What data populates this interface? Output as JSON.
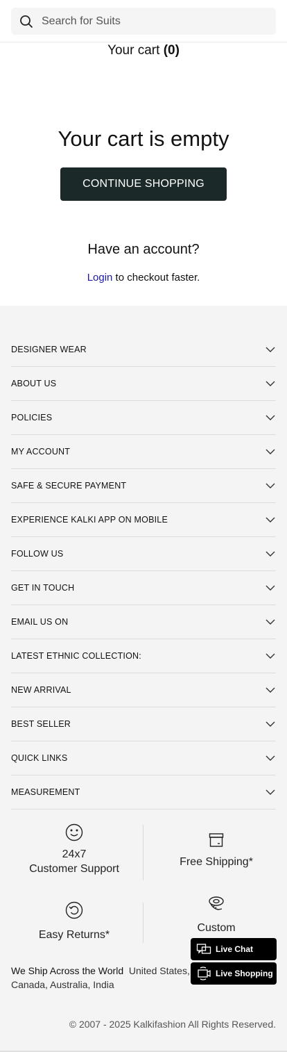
{
  "search": {
    "placeholder": "Search for Suits"
  },
  "cart": {
    "label": "Your cart",
    "count": "(0)"
  },
  "empty": {
    "title": "Your cart is empty",
    "button": "CONTINUE SHOPPING"
  },
  "account": {
    "title": "Have an account?",
    "login": "Login",
    "suffix": " to checkout faster."
  },
  "footer": {
    "sections": [
      "DESIGNER WEAR",
      "ABOUT US",
      "POLICIES",
      "MY ACCOUNT",
      "SAFE & SECURE PAYMENT",
      "EXPERIENCE KALKI APP ON MOBILE",
      "FOLLOW US",
      "GET IN TOUCH",
      "EMAIL US ON",
      "LATEST ETHNIC COLLECTION:",
      "NEW ARRIVAL",
      "BEST SELLER",
      "QUICK LINKS",
      "MEASUREMENT"
    ],
    "features": {
      "support_line1": "24x7",
      "support_line2": "Customer Support",
      "shipping": "Free Shipping*",
      "returns": "Easy Returns*",
      "custom": "Custom"
    },
    "ship": {
      "title": "We Ship Across the World",
      "countries": "United States, UK, Canada, Australia, India"
    },
    "copyright": "© 2007 - 2025 Kalkifashion All Rights Reserved."
  },
  "live": {
    "chat": "Live Chat",
    "shopping": "Live Shopping"
  },
  "colors": {
    "primary_button": "#1b2a28",
    "link": "#1a1aa6",
    "footer_bg": "#f4f4f4",
    "live_bg": "#000000"
  }
}
